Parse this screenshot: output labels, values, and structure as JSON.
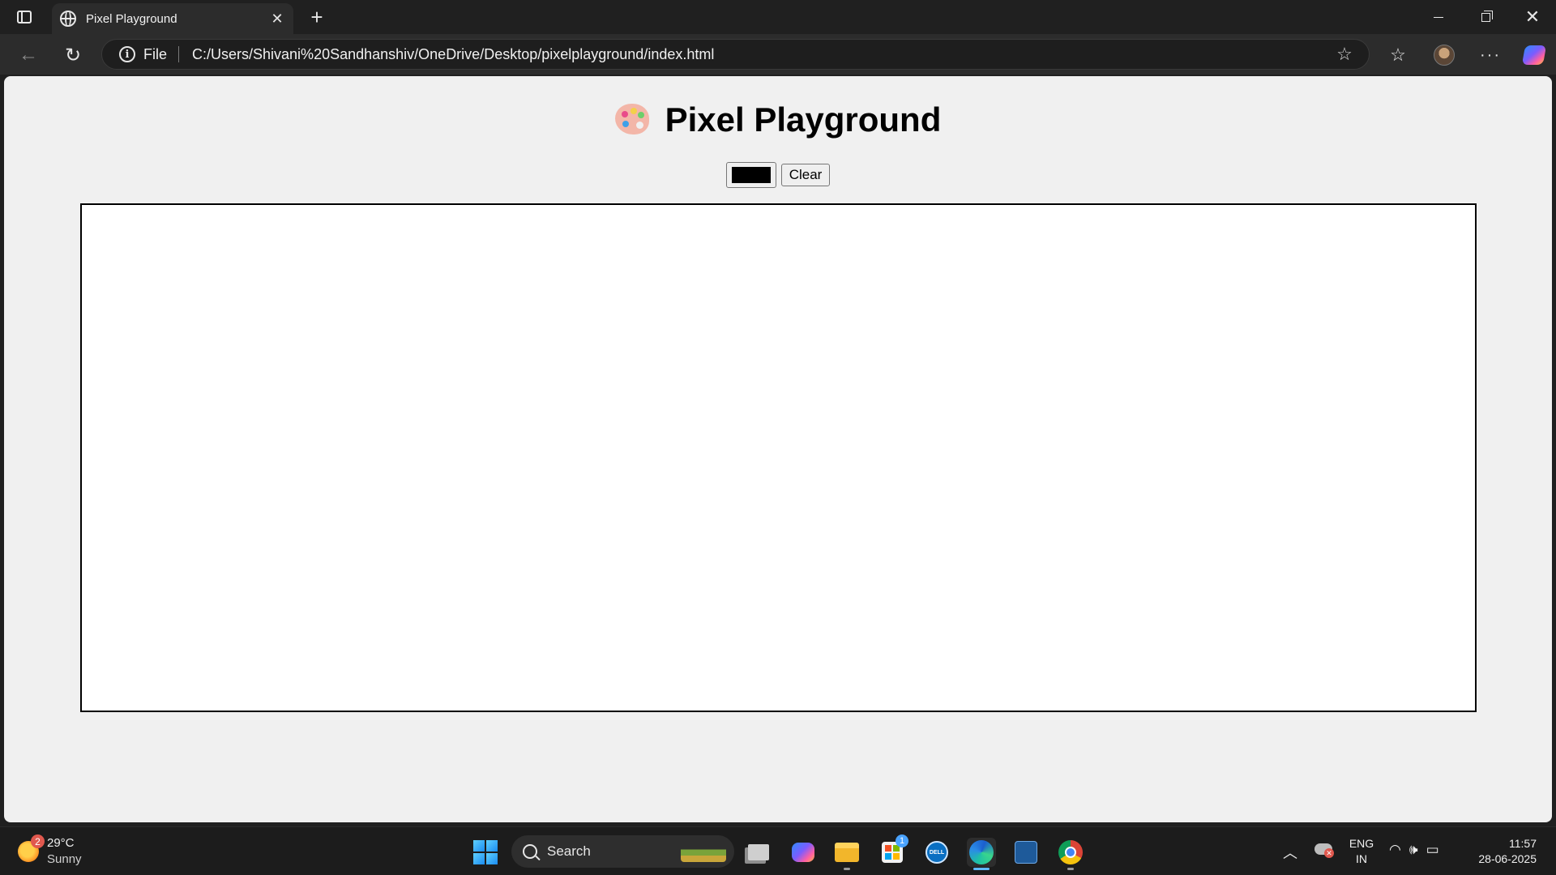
{
  "browser": {
    "tab_title": "Pixel Playground",
    "address_scheme": "File",
    "address_url": "C:/Users/Shivani%20Sandhanshiv/OneDrive/Desktop/pixelplayground/index.html"
  },
  "page": {
    "title": "Pixel Playground",
    "title_emoji": "palette-icon",
    "color_picker_value": "#000000",
    "clear_button_label": "Clear"
  },
  "taskbar": {
    "weather_badge": "2",
    "temperature": "29°C",
    "condition": "Sunny",
    "search_label": "Search",
    "store_badge": "1",
    "dell_label": "DELL",
    "language_top": "ENG",
    "language_bottom": "IN",
    "time": "11:57",
    "date": "28-06-2025"
  },
  "colors": {
    "page_background": "#f0f0f0",
    "canvas_background": "#ffffff",
    "canvas_border": "#000000",
    "browser_chrome": "#202020"
  }
}
